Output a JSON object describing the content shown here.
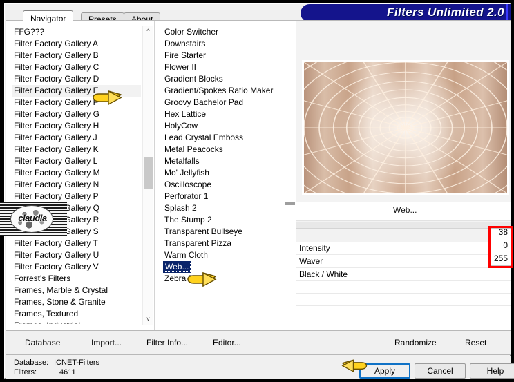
{
  "app": {
    "banner_title": "Filters Unlimited 2.0",
    "watermark_text": "claudia"
  },
  "tabs": [
    {
      "label": "Navigator",
      "active": true
    },
    {
      "label": "Presets",
      "active": false
    },
    {
      "label": "About",
      "active": false
    }
  ],
  "navigator_list": {
    "items": [
      "FFG???",
      "Filter Factory Gallery A",
      "Filter Factory Gallery B",
      "Filter Factory Gallery C",
      "Filter Factory Gallery D",
      "Filter Factory Gallery E",
      "Filter Factory Gallery F",
      "Filter Factory Gallery G",
      "Filter Factory Gallery H",
      "Filter Factory Gallery J",
      "Filter Factory Gallery K",
      "Filter Factory Gallery L",
      "Filter Factory Gallery M",
      "Filter Factory Gallery N",
      "Filter Factory Gallery P",
      "Filter Factory Gallery Q",
      "Filter Factory Gallery R",
      "Filter Factory Gallery S",
      "Filter Factory Gallery T",
      "Filter Factory Gallery U",
      "Filter Factory Gallery V",
      "Forrest's Filters",
      "Frames, Marble & Crystal",
      "Frames, Stone & Granite",
      "Frames, Textured"
    ],
    "highlighted": "Filter Factory Gallery E"
  },
  "filter_list": {
    "items": [
      "Color Switcher",
      "Downstairs",
      "Fire Starter",
      "Flower II",
      "Gradient Blocks",
      "Gradient/Spokes Ratio Maker",
      "Groovy Bachelor Pad",
      "Hex Lattice",
      "HolyCow",
      "Lead Crystal Emboss",
      "Metal Peacocks",
      "Metalfalls",
      "Mo' Jellyfish",
      "Oscilloscope",
      "Perforator 1",
      "Splash 2",
      "The Stump 2",
      "Transparent Bullseye",
      "Transparent Pizza",
      "Warm Cloth",
      "Web...",
      "Zebra Fan"
    ],
    "selected": "Web..."
  },
  "current_filter": {
    "name": "Web..."
  },
  "parameters": [
    {
      "label": "Intensity",
      "value": "38"
    },
    {
      "label": "Waver",
      "value": "0"
    },
    {
      "label": "Black / White",
      "value": "255"
    }
  ],
  "toolbar": {
    "database_label": "Database",
    "import_label": "Import...",
    "filter_info_label": "Filter Info...",
    "editor_label": "Editor...",
    "randomize_label": "Randomize",
    "reset_label": "Reset"
  },
  "status": {
    "database_key": "Database:",
    "database_value": "ICNET-Filters",
    "filters_key": "Filters:",
    "filters_value": "4611"
  },
  "dialog_buttons": {
    "apply": "Apply",
    "cancel": "Cancel",
    "help": "Help"
  },
  "colors": {
    "banner": "#14148c",
    "selection": "#0a246a",
    "annotation": "#ff0000",
    "focus": "#1072c6"
  }
}
